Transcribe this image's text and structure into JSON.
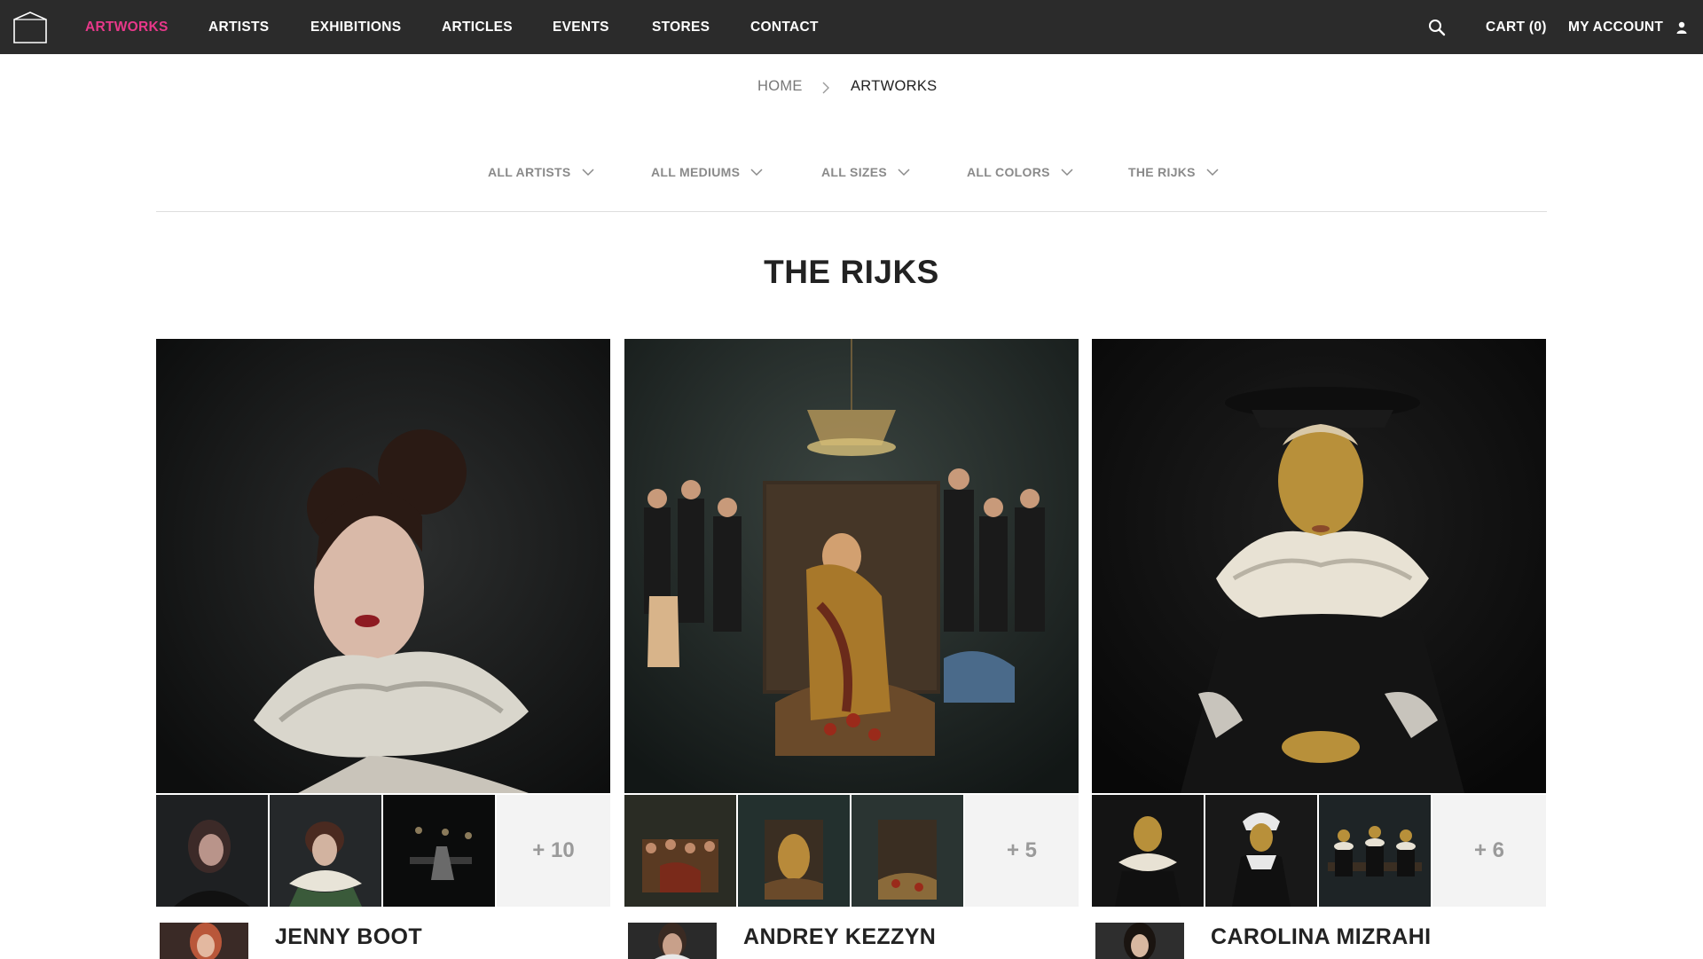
{
  "nav": {
    "items": [
      {
        "label": "ARTWORKS",
        "active": true
      },
      {
        "label": "ARTISTS",
        "active": false
      },
      {
        "label": "EXHIBITIONS",
        "active": false
      },
      {
        "label": "ARTICLES",
        "active": false
      },
      {
        "label": "EVENTS",
        "active": false
      },
      {
        "label": "STORES",
        "active": false
      },
      {
        "label": "CONTACT",
        "active": false
      }
    ],
    "cart_label": "CART (0)",
    "account_label": "MY ACCOUNT",
    "search_icon": "search-icon",
    "user_icon": "user-icon",
    "active_color": "#e8388a",
    "background": "#2b2b2b"
  },
  "breadcrumb": {
    "home": "HOME",
    "current": "ARTWORKS"
  },
  "filters": [
    {
      "label": "ALL ARTISTS"
    },
    {
      "label": "ALL MEDIUMS"
    },
    {
      "label": "ALL SIZES"
    },
    {
      "label": "ALL COLORS"
    },
    {
      "label": "THE RIJKS"
    }
  ],
  "page_title": "THE RIJKS",
  "cards": [
    {
      "artist": "JENNY BOOT",
      "more": "+ 10"
    },
    {
      "artist": "ANDREY KEZZYN",
      "more": "+ 5"
    },
    {
      "artist": "CAROLINA MIZRAHI",
      "more": "+ 6"
    }
  ]
}
